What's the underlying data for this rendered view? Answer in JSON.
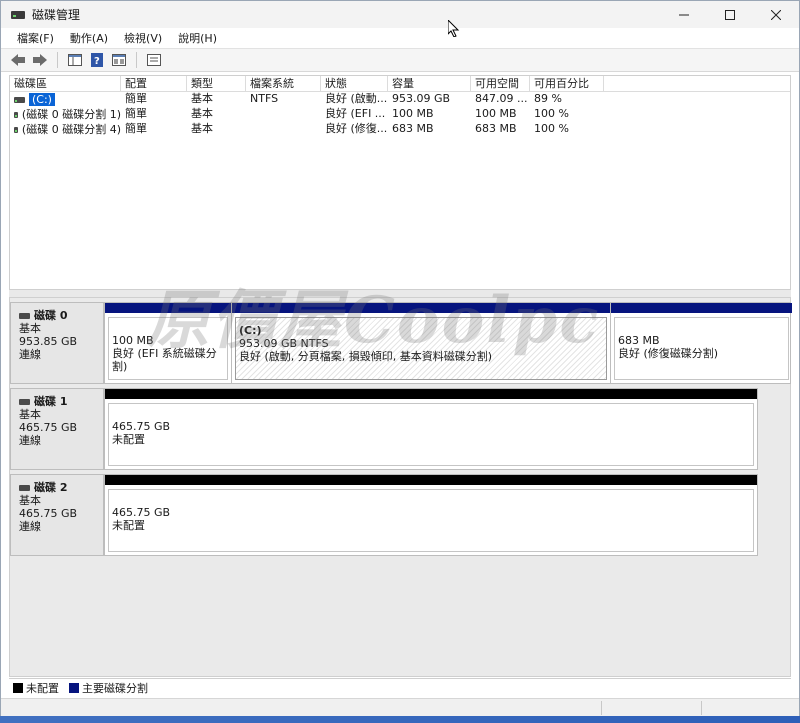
{
  "window": {
    "title": "磁碟管理"
  },
  "window_controls": {
    "minimize": "—",
    "maximize": "☐",
    "close": "✕"
  },
  "menu": [
    "檔案(F)",
    "動作(A)",
    "檢視(V)",
    "說明(H)"
  ],
  "toolbar": {
    "buttons": [
      "back-icon",
      "forward-icon",
      "console-tree-icon",
      "help-icon",
      "properties-icon",
      "list-view-icon"
    ]
  },
  "volume_list": {
    "columns": [
      "磁碟區",
      "配置",
      "類型",
      "檔案系統",
      "狀態",
      "容量",
      "可用空間",
      "可用百分比"
    ],
    "rows": [
      {
        "volume": "(C:)",
        "layout": "簡單",
        "type": "基本",
        "fs": "NTFS",
        "status": "良好 (啟動...",
        "capacity": "953.09 GB",
        "free": "847.09 ...",
        "pct": "89 %"
      },
      {
        "volume": "(磁碟 0 磁碟分割 1)",
        "layout": "簡單",
        "type": "基本",
        "fs": "",
        "status": "良好 (EFI ...",
        "capacity": "100 MB",
        "free": "100 MB",
        "pct": "100 %"
      },
      {
        "volume": "(磁碟 0 磁碟分割 4)",
        "layout": "簡單",
        "type": "基本",
        "fs": "",
        "status": "良好 (修復...",
        "capacity": "683 MB",
        "free": "683 MB",
        "pct": "100 %"
      }
    ]
  },
  "disks": [
    {
      "name": "磁碟 0",
      "type": "基本",
      "size": "953.85 GB",
      "state": "連線",
      "partitions": [
        {
          "line1": "100 MB",
          "line2": "良好 (EFI 系統磁碟分割)",
          "title": ""
        },
        {
          "title": "(C:)",
          "line1": "953.09 GB NTFS",
          "line2": "良好 (啟動, 分頁檔案, 損毀傾印, 基本資料磁碟分割)"
        },
        {
          "line1": "683 MB",
          "line2": "良好 (修復磁碟分割)",
          "title": ""
        }
      ]
    },
    {
      "name": "磁碟 1",
      "type": "基本",
      "size": "465.75 GB",
      "state": "連線",
      "partitions": [
        {
          "line1": "465.75 GB",
          "line2": "未配置"
        }
      ]
    },
    {
      "name": "磁碟 2",
      "type": "基本",
      "size": "465.75 GB",
      "state": "連線",
      "partitions": [
        {
          "line1": "465.75 GB",
          "line2": "未配置"
        }
      ]
    }
  ],
  "legend": [
    {
      "label": "未配置",
      "color": "#000000"
    },
    {
      "label": "主要磁碟分割",
      "color": "#06147e"
    }
  ],
  "watermark": "原價屋Coolpc"
}
